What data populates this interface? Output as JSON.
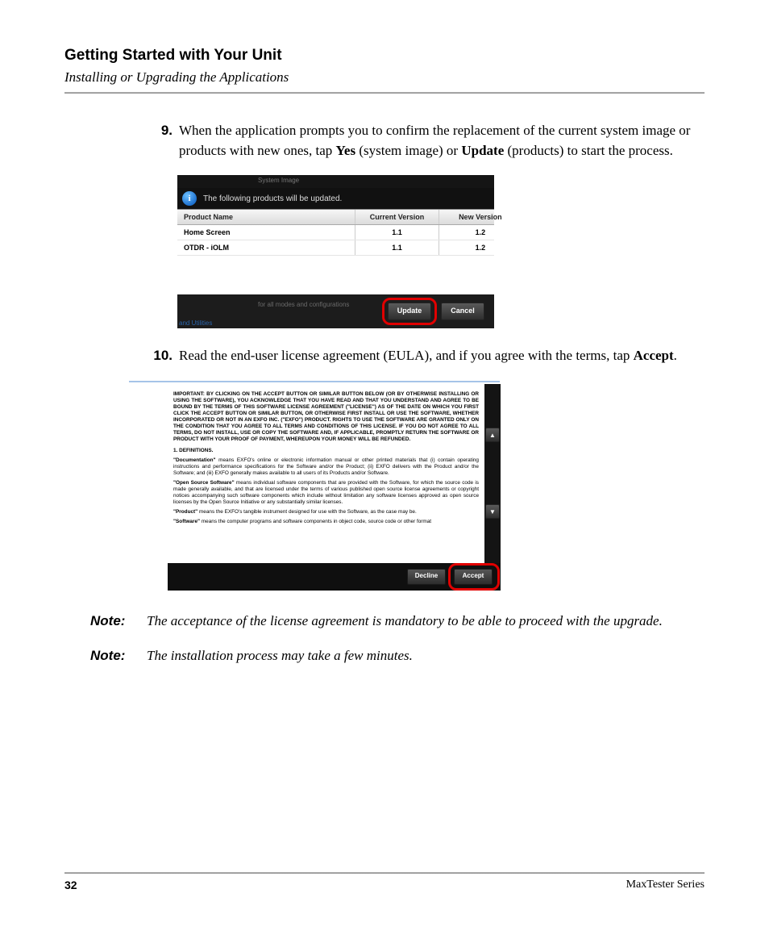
{
  "header": {
    "title": "Getting Started with Your Unit",
    "subtitle": "Installing or Upgrading the Applications"
  },
  "steps": {
    "s9": {
      "num": "9.",
      "part1": "When the application prompts you to confirm the replacement of the current system image or products with new ones, tap ",
      "bold1": "Yes",
      "part2": " (system image) or ",
      "bold2": "Update",
      "part3": " (products) to start the process."
    },
    "s10": {
      "num": "10.",
      "part1": "Read the end-user license agreement (EULA), and if you agree with the terms, tap ",
      "bold1": "Accept",
      "part2": "."
    }
  },
  "dialog1": {
    "tab_label": "System Image",
    "message": "The following products will be updated.",
    "columns": {
      "c1": "Product Name",
      "c2": "Current Version",
      "c3": "New Version"
    },
    "rows": [
      {
        "name": "Home Screen",
        "cur": "1.1",
        "new": "1.2"
      },
      {
        "name": "OTDR - iOLM",
        "cur": "1.1",
        "new": "1.2"
      }
    ],
    "subtext": "for all modes and configurations",
    "foottext": "and Utilities",
    "buttons": {
      "update": "Update",
      "cancel": "Cancel"
    }
  },
  "dialog2": {
    "important": "IMPORTANT: BY CLICKING ON THE ACCEPT BUTTON OR SIMILAR BUTTON BELOW (OR BY OTHERWISE INSTALLING OR USING THE SOFTWARE), YOU ACKNOWLEDGE THAT YOU HAVE READ AND THAT YOU UNDERSTAND AND AGREE TO BE BOUND BY THE TERMS OF THIS SOFTWARE LICENSE AGREEMENT (\"LICENSE\") AS OF THE DATE ON WHICH YOU FIRST CLICK THE ACCEPT BUTTON OR SIMILAR BUTTON, OR OTHERWISE FIRST INSTALL OR USE THE SOFTWARE, WHETHER INCORPORATED OR NOT IN AN EXFO INC. (\"EXFO\") PRODUCT. RIGHTS TO USE THE SOFTWARE ARE GRANTED ONLY ON THE CONDITION THAT YOU AGREE TO ALL TERMS AND CONDITIONS OF THIS LICENSE. IF YOU DO NOT AGREE TO ALL TERMS, DO NOT INSTALL, USE OR COPY THE SOFTWARE AND, IF APPLICABLE, PROMPTLY RETURN THE SOFTWARE OR PRODUCT WITH YOUR PROOF OF PAYMENT, WHEREUPON YOUR MONEY WILL BE REFUNDED.",
    "section1": "1.  DEFINITIONS.",
    "def_doc_label": "\"Documentation\"",
    "def_doc": " means EXFO's online or electronic information manual or other printed materials that (i) contain operating instructions and performance specifications for the Software and/or the Product; (ii) EXFO delivers with the Product and/or the Software; and (iii) EXFO generally makes available to all users of its Products and/or Software.",
    "def_oss_label": "\"Open Source Software\"",
    "def_oss": " means individual software components that are provided with the Software, for which the source code is made generally available, and that are licensed under the terms of various published open source license agreements or copyright notices accompanying such software components which include without limitation any software licenses approved as open source licenses by the Open Source Initiative or any substantially similar licenses.",
    "def_prod_label": "\"Product\"",
    "def_prod": " means the EXFO's tangible instrument designed for use with the Software, as the case may be.",
    "def_sw_label": "\"Software\"",
    "def_sw": " means the computer programs and software components in object code, source code or other format",
    "buttons": {
      "decline": "Decline",
      "accept": "Accept"
    }
  },
  "notes": {
    "label": "Note:",
    "n1": "The acceptance of the license agreement is mandatory to be able to proceed with the upgrade.",
    "n2": "The installation process may take a few minutes."
  },
  "footer": {
    "page": "32",
    "product": "MaxTester Series"
  }
}
